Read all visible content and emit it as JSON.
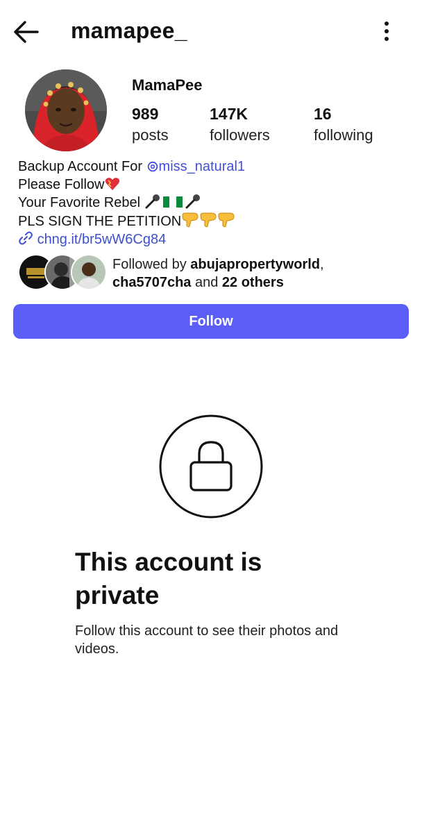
{
  "header": {
    "username": "mamapee_"
  },
  "profile": {
    "display_name": "MamaPee",
    "stats": [
      {
        "value": "989",
        "label": "posts"
      },
      {
        "value": "147K",
        "label": "followers"
      },
      {
        "value": "16",
        "label": "following"
      }
    ],
    "bio": {
      "line1_prefix": "Backup Account For ",
      "line1_mention": "miss_natural1",
      "line2": "Please Follow",
      "line3": "Your Favorite Rebel ",
      "line4": "PLS SIGN THE PETITION",
      "link": "chng.it/br5wW6Cg84"
    },
    "followed_by": {
      "prefix": "Followed by ",
      "user1": "abujapropertyworld",
      "sep": ",",
      "user2": "cha5707cha",
      "middle": " and ",
      "others": "22 others"
    }
  },
  "actions": {
    "follow_label": "Follow"
  },
  "private_notice": {
    "title": "This account is private",
    "subtitle": "Follow this account to see their photos and videos."
  },
  "colors": {
    "follow_button": "#5b5ef6",
    "link": "#3d4fd0"
  }
}
